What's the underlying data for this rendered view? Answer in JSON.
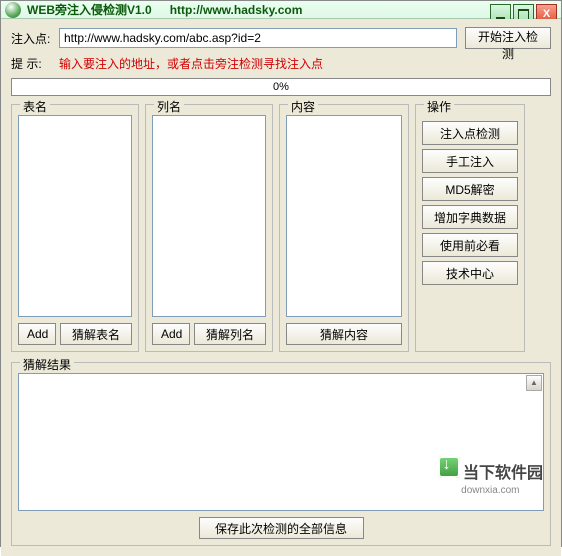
{
  "title": "WEB旁注入侵检测V1.0",
  "title_url": "http://www.hadsky.com",
  "labels": {
    "inject_point": "注入点:",
    "hint": "提 示:"
  },
  "url_value": "http://www.hadsky.com/abc.asp?id=2",
  "start_btn": "开始注入检测",
  "hint_text": "输入要注入的地址，或者点击旁注检测寻找注入点",
  "progress": "0%",
  "groups": {
    "table": "表名",
    "column": "列名",
    "content": "内容",
    "ops": "操作",
    "result": "猜解结果"
  },
  "btns": {
    "add": "Add",
    "guess_table": "猜解表名",
    "guess_column": "猜解列名",
    "guess_content": "猜解内容",
    "save": "保存此次检测的全部信息"
  },
  "ops_btns": [
    "注入点检测",
    "手工注入",
    "MD5解密",
    "增加字典数据",
    "使用前必看",
    "技术中心"
  ],
  "watermark": {
    "name": "当下软件园",
    "domain": "downxia.com"
  }
}
